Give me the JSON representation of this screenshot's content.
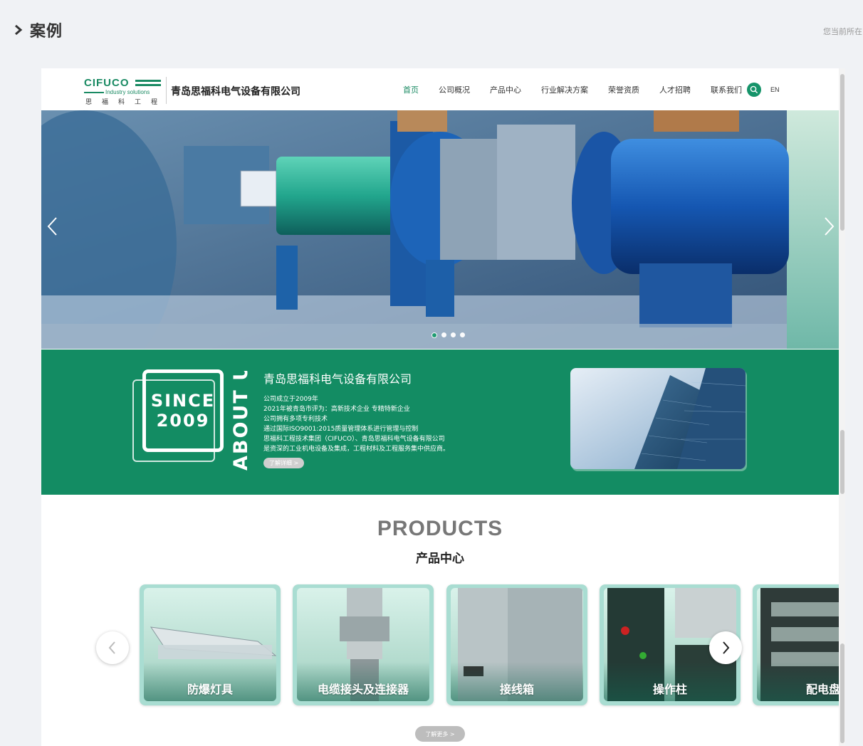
{
  "page": {
    "title": "案例",
    "breadcrumb": "您当前所在"
  },
  "site": {
    "logo": {
      "brand": "CIFUCO",
      "tagline": "Industry solutions",
      "cn": "思福科工程"
    },
    "company": "青岛思福科电气设备有限公司",
    "menu": [
      "首页",
      "公司概况",
      "产品中心",
      "行业解决方案",
      "荣誉资质",
      "人才招聘",
      "联系我们"
    ],
    "active_menu": "首页",
    "lang": "EN"
  },
  "banner": {
    "slide_count": 4,
    "active_slide": 1
  },
  "about": {
    "since_word": "SINCE",
    "since_year": "2009",
    "vertical_label": "ABOUT US",
    "title": "青岛思福科电气设备有限公司",
    "lines": [
      "公司成立于2009年",
      "2021年被青岛市评为：高新技术企业 专精特新企业",
      "公司拥有多项专利技术",
      "通过国际ISO9001:2015质量管理体系进行管理与控制",
      "思福科工程技术集团（CIFUCO）、青岛思福科电气设备有限公司",
      "是资深的工业机电设备及集成，工程材料及工程服务集中供应商。"
    ],
    "more": "了解详细 >"
  },
  "products": {
    "title_en": "PRODUCTS",
    "title_cn": "产品中心",
    "items": [
      "防爆灯具",
      "电缆接头及连接器",
      "接线箱",
      "操作柱",
      "配电盘"
    ],
    "more": "了解更多 >"
  },
  "colors": {
    "brand_green": "#138c63",
    "accent": "#1a8a63"
  }
}
